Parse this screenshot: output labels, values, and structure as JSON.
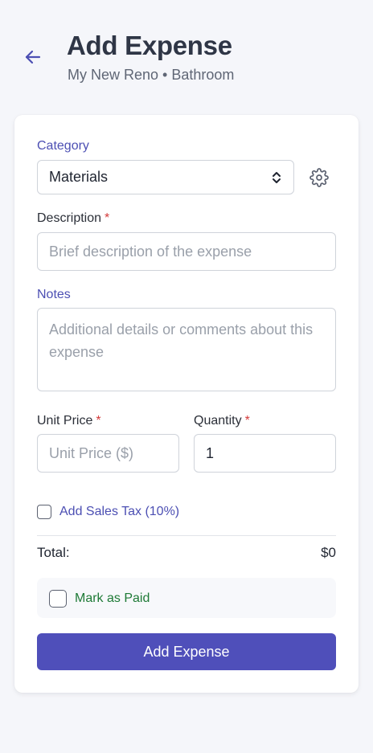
{
  "header": {
    "title": "Add Expense",
    "subtitle": "My New Reno • Bathroom"
  },
  "form": {
    "category": {
      "label": "Category",
      "value": "Materials"
    },
    "description": {
      "label": "Description",
      "required": "*",
      "placeholder": "Brief description of the expense"
    },
    "notes": {
      "label": "Notes",
      "placeholder": "Additional details or comments about this expense"
    },
    "unit_price": {
      "label": "Unit Price",
      "required": "*",
      "placeholder": "Unit Price ($)"
    },
    "quantity": {
      "label": "Quantity",
      "required": "*",
      "value": "1"
    },
    "sales_tax": {
      "label": "Add Sales Tax (10%)",
      "checked": false
    },
    "total": {
      "label": "Total:",
      "value": "$0"
    },
    "mark_paid": {
      "label": "Mark as Paid",
      "checked": false
    },
    "submit_label": "Add Expense"
  },
  "colors": {
    "accent": "#4f4fba",
    "accent_text": "#4c4fb3",
    "required": "#d33a3a",
    "paid_text": "#1e7a36"
  },
  "icons": {
    "back": "arrow-left-icon",
    "select": "chevron-up-down-icon",
    "settings": "gear-icon"
  }
}
